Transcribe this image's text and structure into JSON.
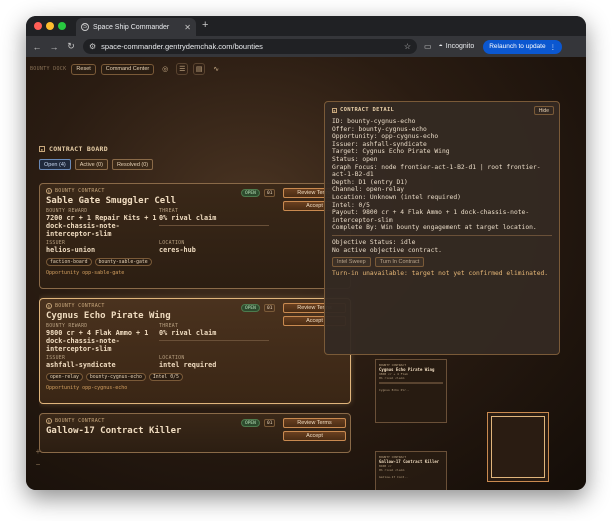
{
  "browser": {
    "tab_title": "Space Ship Commander",
    "tab_favicon": "S",
    "new_tab": "+",
    "url": "space-commander.gentrydemchak.com/bounties",
    "incognito_label": "Incognito",
    "relaunch_label": "Relaunch to update",
    "traffic_colors": [
      "#ff5f57",
      "#febc2e",
      "#28c840"
    ],
    "accent": "#0b57d0"
  },
  "dock": {
    "label": "BOUNTY DOCK",
    "reset": "Reset",
    "command_center": "Command Center"
  },
  "board": {
    "title": "CONTRACT BOARD",
    "filters": [
      "Open (4)",
      "Active (0)",
      "Resolved (0)"
    ],
    "cards": [
      {
        "kicker": "BOUNTY CONTRACT",
        "title": "Sable Gate Smuggler Cell",
        "status": "OPEN",
        "index": "01",
        "reward_label": "BOUNTY REWARD",
        "reward": "7200 cr + 1 Repair Kits + 1 dock-chassis-note-interceptor-slim",
        "threat_label": "THREAT",
        "threat": "0% rival claim",
        "issuer_label": "ISSUER",
        "issuer": "helios-union",
        "location_label": "LOCATION",
        "location": "ceres-hub",
        "chips": [
          "faction-board",
          "bounty-sable-gate"
        ],
        "opportunity": "Opportunity opp-sable-gate",
        "review": "Review Terms",
        "accept": "Accept"
      },
      {
        "kicker": "BOUNTY CONTRACT",
        "title": "Cygnus Echo Pirate Wing",
        "status": "OPEN",
        "index": "01",
        "reward_label": "BOUNTY REWARD",
        "reward": "9800 cr + 4 Flak Ammo + 1 dock-chassis-note-interceptor-slim",
        "threat_label": "THREAT",
        "threat": "0% rival claim",
        "issuer_label": "ISSUER",
        "issuer": "ashfall-syndicate",
        "location_label": "LOCATION",
        "location": "intel required",
        "chips": [
          "open-relay",
          "bounty-cygnus-echo",
          "Intel 0/5"
        ],
        "opportunity": "Opportunity opp-cygnus-echo",
        "review": "Review Terms",
        "accept": "Accept"
      },
      {
        "kicker": "BOUNTY CONTRACT",
        "title": "Gallow-17 Contract Killer",
        "status": "OPEN",
        "index": "01",
        "review": "Review Terms",
        "accept": "Accept"
      }
    ]
  },
  "detail": {
    "title": "CONTRACT DETAIL",
    "hide": "Hide",
    "lines": [
      "ID: bounty-cygnus-echo",
      "Offer: bounty-cygnus-echo",
      "Opportunity: opp-cygnus-echo",
      "Issuer: ashfall-syndicate",
      "Target: Cygnus Echo Pirate Wing",
      "Status: open",
      "Graph Focus: node frontier-act-1-B2-d1 | root frontier-act-1-B2-d1",
      "Depth: D1 (entry D1)",
      "Channel: open-relay",
      "Location: Unknown (intel required)",
      "Intel: 0/5",
      "Payout: 9800 cr + 4 Flak Ammo + 1 dock-chassis-note-interceptor-slim",
      "Complete By: Win bounty engagement at target location."
    ],
    "objective_status": "Objective Status: idle",
    "objective_note": "No active objective contract.",
    "intel_sweep": "Intel Sweep",
    "turn_in": "Turn In Contract",
    "warning": "Turn-in unavailable: target not yet confirmed eliminated."
  },
  "minimap": {
    "card_a": {
      "kicker": "BOUNTY CONTRACT",
      "title": "Cygnus Echo Pirate Wing",
      "sub": "9800 cr + 4 Flak",
      "threat": "0% rival claim",
      "foot": "Cygnus Echo Pir.."
    },
    "card_b": {
      "kicker": "BOUNTY CONTRACT",
      "title": "Gallow-17 Contract Killer",
      "sub": "8400 cr",
      "threat": "0% rival claim",
      "foot": "Gallow-17 Cont.."
    }
  },
  "zoom": {
    "in": "+",
    "out": "−"
  }
}
